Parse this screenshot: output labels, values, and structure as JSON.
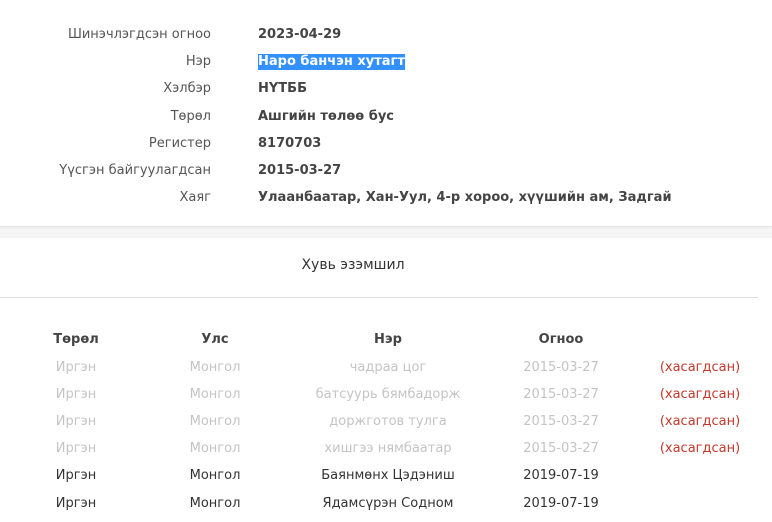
{
  "info": {
    "rows": [
      {
        "label": "Шинэчлэгдсэн огноо",
        "value": "2023-04-29"
      },
      {
        "label": "Нэр",
        "value": "Наро банчэн хутагт"
      },
      {
        "label": "Хэлбэр",
        "value": "НҮТББ"
      },
      {
        "label": "Төрөл",
        "value": "Ашгийн төлөө бус"
      },
      {
        "label": "Регистер",
        "value": "8170703"
      },
      {
        "label": "Үүсгэн байгуулагдсан",
        "value": "2015-03-27"
      },
      {
        "label": "Хаяг",
        "value": "Улаанбаатар, Хан-Уул, 4-р хороо, хүүшийн ам, Задгай"
      }
    ]
  },
  "ownership": {
    "title": "Хувь эзэмшил",
    "headers": {
      "type": "Төрөл",
      "country": "Улс",
      "name": "Нэр",
      "date": "Огноо"
    },
    "rows": [
      {
        "type": "Иргэн",
        "country": "Монгол",
        "name": "чадраа цог",
        "date": "2015-03-27",
        "status": "(хасагдсан)"
      },
      {
        "type": "Иргэн",
        "country": "Монгол",
        "name": "батсуурь бямбадорж",
        "date": "2015-03-27",
        "status": "(хасагдсан)"
      },
      {
        "type": "Иргэн",
        "country": "Монгол",
        "name": "доржготов тулга",
        "date": "2015-03-27",
        "status": "(хасагдсан)"
      },
      {
        "type": "Иргэн",
        "country": "Монгол",
        "name": "хишгээ нямбаатар",
        "date": "2015-03-27",
        "status": "(хасагдсан)"
      },
      {
        "type": "Иргэн",
        "country": "Монгол",
        "name": "Баянмөнх Цэдэниш",
        "date": "2019-07-19",
        "status": ""
      },
      {
        "type": "Иргэн",
        "country": "Монгол",
        "name": "Ядамсүрэн Содном",
        "date": "2019-07-19",
        "status": ""
      }
    ]
  },
  "colors": {
    "removed_status": "#c0392b",
    "removed_text": "#c4c4c4",
    "selection": "#3390ff"
  }
}
